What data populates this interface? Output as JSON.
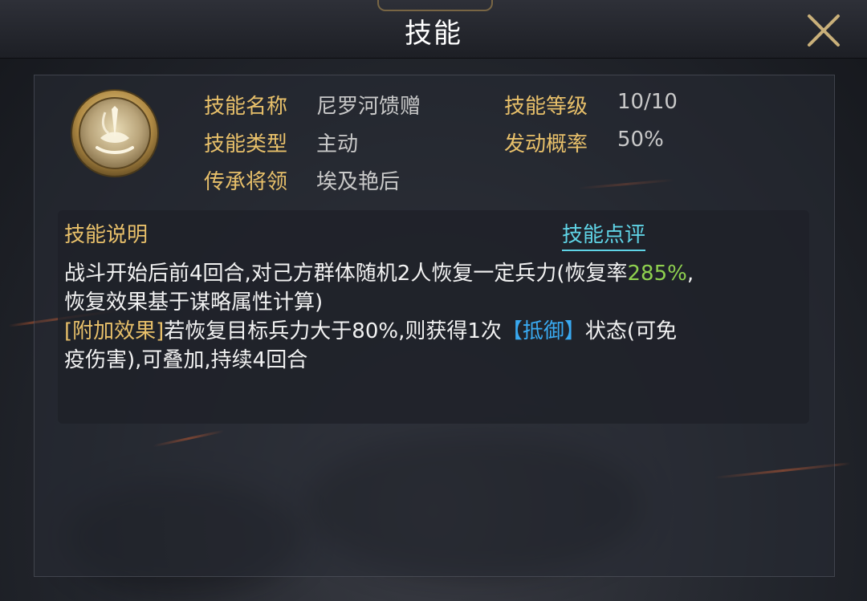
{
  "window": {
    "title": "技能"
  },
  "skill": {
    "icon": "skill-emblem-icon",
    "name_label": "技能名称",
    "name": "尼罗河馈赠",
    "level_label": "技能等级",
    "level": "10/10",
    "type_label": "技能类型",
    "type": "主动",
    "chance_label": "发动概率",
    "chance": "50%",
    "inherit_label": "传承将领",
    "inherit": "埃及艳后"
  },
  "description": {
    "title": "技能说明",
    "review_link": "技能点评",
    "line1_text": "战斗开始后前4回合,对己方群体随机2人恢复一定兵力(恢复率",
    "line1_highlight": "285%",
    "line1_tail": ",",
    "line2_text": "恢复效果基于谋略属性计算)",
    "line3_tag": "[附加效果]",
    "line3_text": "若恢复目标兵力大于80%,则获得1次",
    "line3_status": "【抵御】",
    "line3_tail": "状态(可免",
    "line4_text": "疫伤害),可叠加,持续4回合"
  },
  "colors": {
    "label_gold": "#e8c06a",
    "highlight_green": "#8fd14f",
    "status_blue": "#39a9f0",
    "link_cyan": "#5fd4e6"
  }
}
